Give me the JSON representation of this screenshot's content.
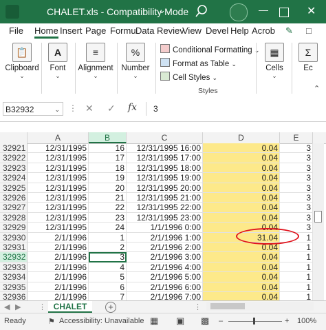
{
  "window": {
    "title": "CHALET.xls  -  Compatibility Mode",
    "accent": "#217346"
  },
  "tabs": [
    "File",
    "Home",
    "Insert",
    "Page",
    "Form",
    "Data",
    "Review",
    "View",
    "Develo",
    "Help",
    "Acrob"
  ],
  "tabs_display": [
    "File",
    "Home",
    "Insert",
    "Page",
    "Formu",
    "Data",
    "Reviev",
    "View",
    "Devel",
    "Help",
    "Acrob"
  ],
  "active_tab": "Home",
  "ribbon": {
    "clipboard": "Clipboard",
    "font": "Font",
    "alignment": "Alignment",
    "number": "Number",
    "conditional_formatting": "Conditional Formatting",
    "format_as_table": "Format as Table",
    "cell_styles": "Cell Styles",
    "styles_group": "Styles",
    "cells": "Cells",
    "editing": "Ec"
  },
  "formula_bar": {
    "name_box": "B32932",
    "formula": "3"
  },
  "columns": [
    "A",
    "B",
    "C",
    "D",
    "E"
  ],
  "rows": [
    {
      "n": "32921",
      "a": "12/31/1995",
      "b": "16",
      "c": "12/31/1995 16:00",
      "d": "0.04",
      "e": "3"
    },
    {
      "n": "32922",
      "a": "12/31/1995",
      "b": "17",
      "c": "12/31/1995 17:00",
      "d": "0.04",
      "e": "3"
    },
    {
      "n": "32923",
      "a": "12/31/1995",
      "b": "18",
      "c": "12/31/1995 18:00",
      "d": "0.04",
      "e": "3"
    },
    {
      "n": "32924",
      "a": "12/31/1995",
      "b": "19",
      "c": "12/31/1995 19:00",
      "d": "0.04",
      "e": "3"
    },
    {
      "n": "32925",
      "a": "12/31/1995",
      "b": "20",
      "c": "12/31/1995 20:00",
      "d": "0.04",
      "e": "3"
    },
    {
      "n": "32926",
      "a": "12/31/1995",
      "b": "21",
      "c": "12/31/1995 21:00",
      "d": "0.04",
      "e": "3"
    },
    {
      "n": "32927",
      "a": "12/31/1995",
      "b": "22",
      "c": "12/31/1995 22:00",
      "d": "0.04",
      "e": "3"
    },
    {
      "n": "32928",
      "a": "12/31/1995",
      "b": "23",
      "c": "12/31/1995 23:00",
      "d": "0.04",
      "e": "3"
    },
    {
      "n": "32929",
      "a": "12/31/1995",
      "b": "24",
      "c": "1/1/1996 0:00",
      "d": "0.04",
      "e": "3"
    },
    {
      "n": "32930",
      "a": "2/1/1996",
      "b": "1",
      "c": "2/1/1996 1:00",
      "d": "31.04",
      "e": "1"
    },
    {
      "n": "32931",
      "a": "2/1/1996",
      "b": "2",
      "c": "2/1/1996 2:00",
      "d": "0.04",
      "e": "1"
    },
    {
      "n": "32932",
      "a": "2/1/1996",
      "b": "3",
      "c": "2/1/1996 3:00",
      "d": "0.04",
      "e": "1"
    },
    {
      "n": "32933",
      "a": "2/1/1996",
      "b": "4",
      "c": "2/1/1996 4:00",
      "d": "0.04",
      "e": "1"
    },
    {
      "n": "32934",
      "a": "2/1/1996",
      "b": "5",
      "c": "2/1/1996 5:00",
      "d": "0.04",
      "e": "1"
    },
    {
      "n": "32935",
      "a": "2/1/1996",
      "b": "6",
      "c": "2/1/1996 6:00",
      "d": "0.04",
      "e": "1"
    },
    {
      "n": "32936",
      "a": "2/1/1996",
      "b": "7",
      "c": "2/1/1996 7:00",
      "d": "0.04",
      "e": "1"
    }
  ],
  "highlight_color": "#fde98a",
  "annotation_color": "#e0141e",
  "sheet_tab": "CHALET",
  "status": {
    "ready": "Ready",
    "accessibility": "Accessibility: Unavailable",
    "zoom": "100%"
  }
}
